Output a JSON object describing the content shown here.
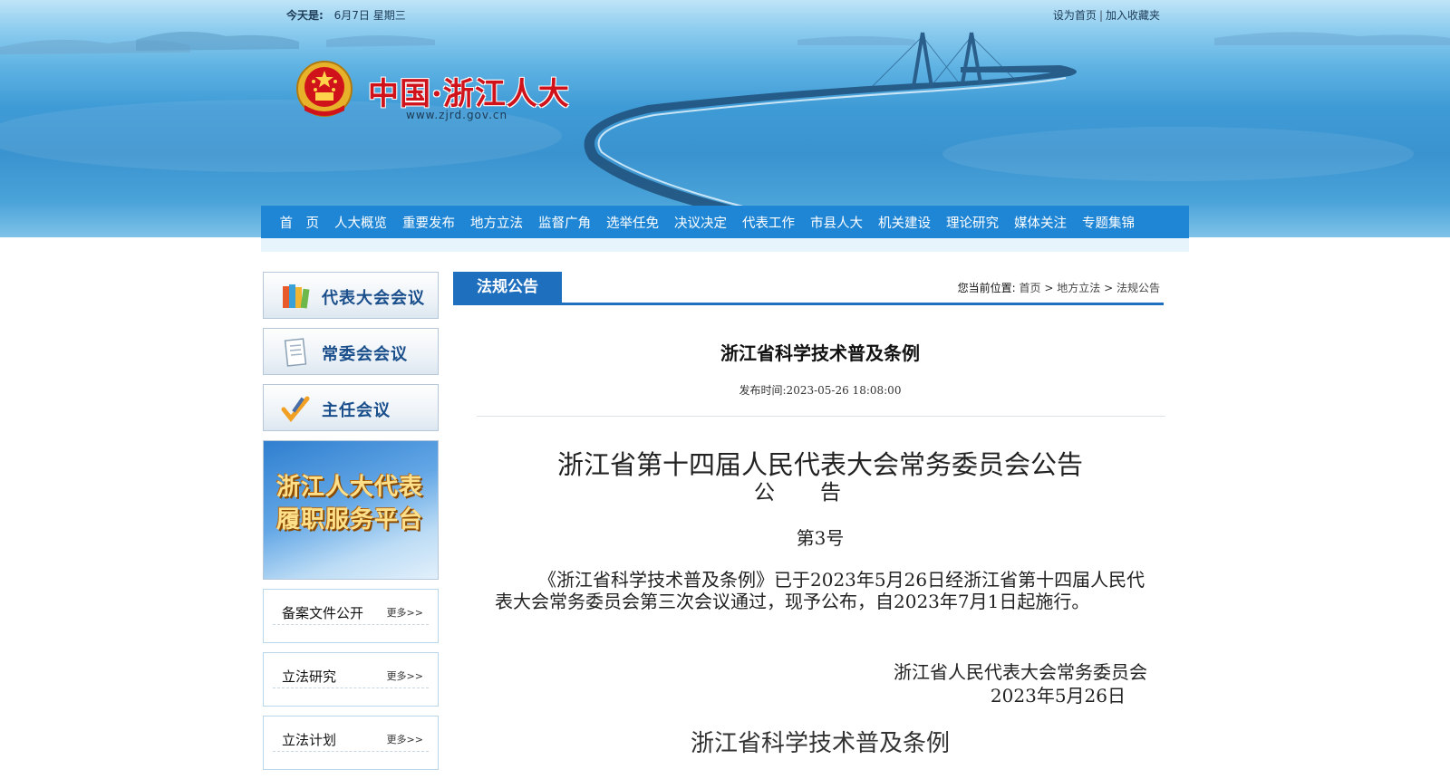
{
  "header": {
    "today_label": "今天是:",
    "today_value": "6月7日 星期三",
    "set_home": "设为首页",
    "separator": "|",
    "add_favorite": "加入收藏夹",
    "logo_text": "中国·浙江人大",
    "logo_url": "www.zjrd.gov.cn"
  },
  "nav": {
    "items": [
      "首　页",
      "人大概览",
      "重要发布",
      "地方立法",
      "监督广角",
      "选举任免",
      "决议决定",
      "代表工作",
      "市县人大",
      "机关建设",
      "理论研究",
      "媒体关注",
      "专题集锦"
    ]
  },
  "sidebar": {
    "buttons": [
      {
        "label": "代表大会会议",
        "icon": "books-icon"
      },
      {
        "label": "常委会会议",
        "icon": "document-icon"
      },
      {
        "label": "主任会议",
        "icon": "checkmark-pen-icon"
      }
    ],
    "promo_line1": "浙江人大代表",
    "promo_line2": "履职服务平台",
    "boxes": [
      {
        "title": "备案文件公开",
        "more": "更多>>"
      },
      {
        "title": "立法研究",
        "more": "更多>>"
      },
      {
        "title": "立法计划",
        "more": "更多>>"
      }
    ]
  },
  "main": {
    "tab_label": "法规公告",
    "breadcrumb_label": "您当前位置:",
    "breadcrumb": [
      "首页",
      "地方立法",
      "法规公告"
    ],
    "breadcrumb_sep": ">",
    "article_title": "浙江省科学技术普及条例",
    "publish_time": "发布时间:2023-05-26 18:08:00",
    "heading1": "浙江省第十四届人民代表大会常务委员会公告",
    "heading2": "公告",
    "number": "第3号",
    "paragraph": "《浙江省科学技术普及条例》已于2023年5月26日经浙江省第十四届人民代表大会常务委员会第三次会议通过，现予公布，自2023年7月1日起施行。",
    "signature_org": "浙江省人民代表大会常务委员会",
    "signature_date": "2023年5月26日",
    "law_title": "浙江省科学技术普及条例"
  },
  "colors": {
    "nav_bg": "#1f86d6",
    "tab_bg": "#1f6fbf",
    "logo_red": "#d0121b",
    "sidebar_label": "#1a4f8c"
  }
}
